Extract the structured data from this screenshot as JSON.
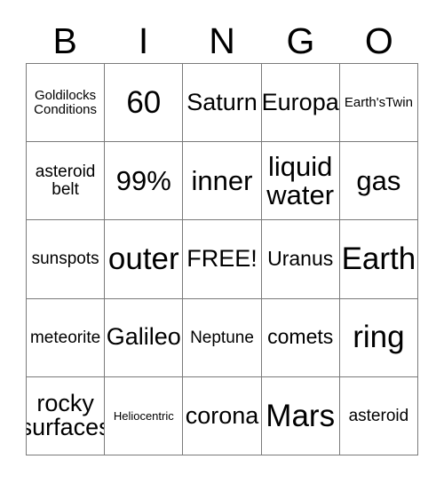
{
  "card": {
    "header_letters": [
      "B",
      "I",
      "N",
      "G",
      "O"
    ],
    "rows": [
      [
        {
          "text": "Goldilocks\nConditions",
          "size": "fs-sm"
        },
        {
          "text": "60",
          "size": "fs-huge"
        },
        {
          "text": "Saturn",
          "size": "fs-xl"
        },
        {
          "text": "Europa",
          "size": "fs-xl"
        },
        {
          "text": "Earth'sTwin",
          "size": "fs-sm"
        }
      ],
      [
        {
          "text": "asteroid\nbelt",
          "size": "fs-md"
        },
        {
          "text": "99%",
          "size": "fs-xxl"
        },
        {
          "text": "inner",
          "size": "fs-xxl"
        },
        {
          "text": "liquid\nwater",
          "size": "fs-xxl"
        },
        {
          "text": "gas",
          "size": "fs-xxl"
        }
      ],
      [
        {
          "text": "sunspots",
          "size": "fs-md"
        },
        {
          "text": "outer",
          "size": "fs-huge"
        },
        {
          "text": "FREE!",
          "size": "fs-xl"
        },
        {
          "text": "Uranus",
          "size": "fs-lg"
        },
        {
          "text": "Earth",
          "size": "fs-huge"
        }
      ],
      [
        {
          "text": "meteorite",
          "size": "fs-md"
        },
        {
          "text": "Galileo",
          "size": "fs-xl"
        },
        {
          "text": "Neptune",
          "size": "fs-md"
        },
        {
          "text": "comets",
          "size": "fs-lg"
        },
        {
          "text": "ring",
          "size": "fs-huge"
        }
      ],
      [
        {
          "text": "rocky\nsurfaces",
          "size": "fs-xl"
        },
        {
          "text": "Heliocentric",
          "size": "fs-xs"
        },
        {
          "text": "corona",
          "size": "fs-xl"
        },
        {
          "text": "Mars",
          "size": "fs-huge"
        },
        {
          "text": "asteroid",
          "size": "fs-md"
        }
      ]
    ]
  },
  "colors": {
    "grid_line": "#7a7a7a",
    "text": "#000000",
    "background": "#ffffff"
  }
}
